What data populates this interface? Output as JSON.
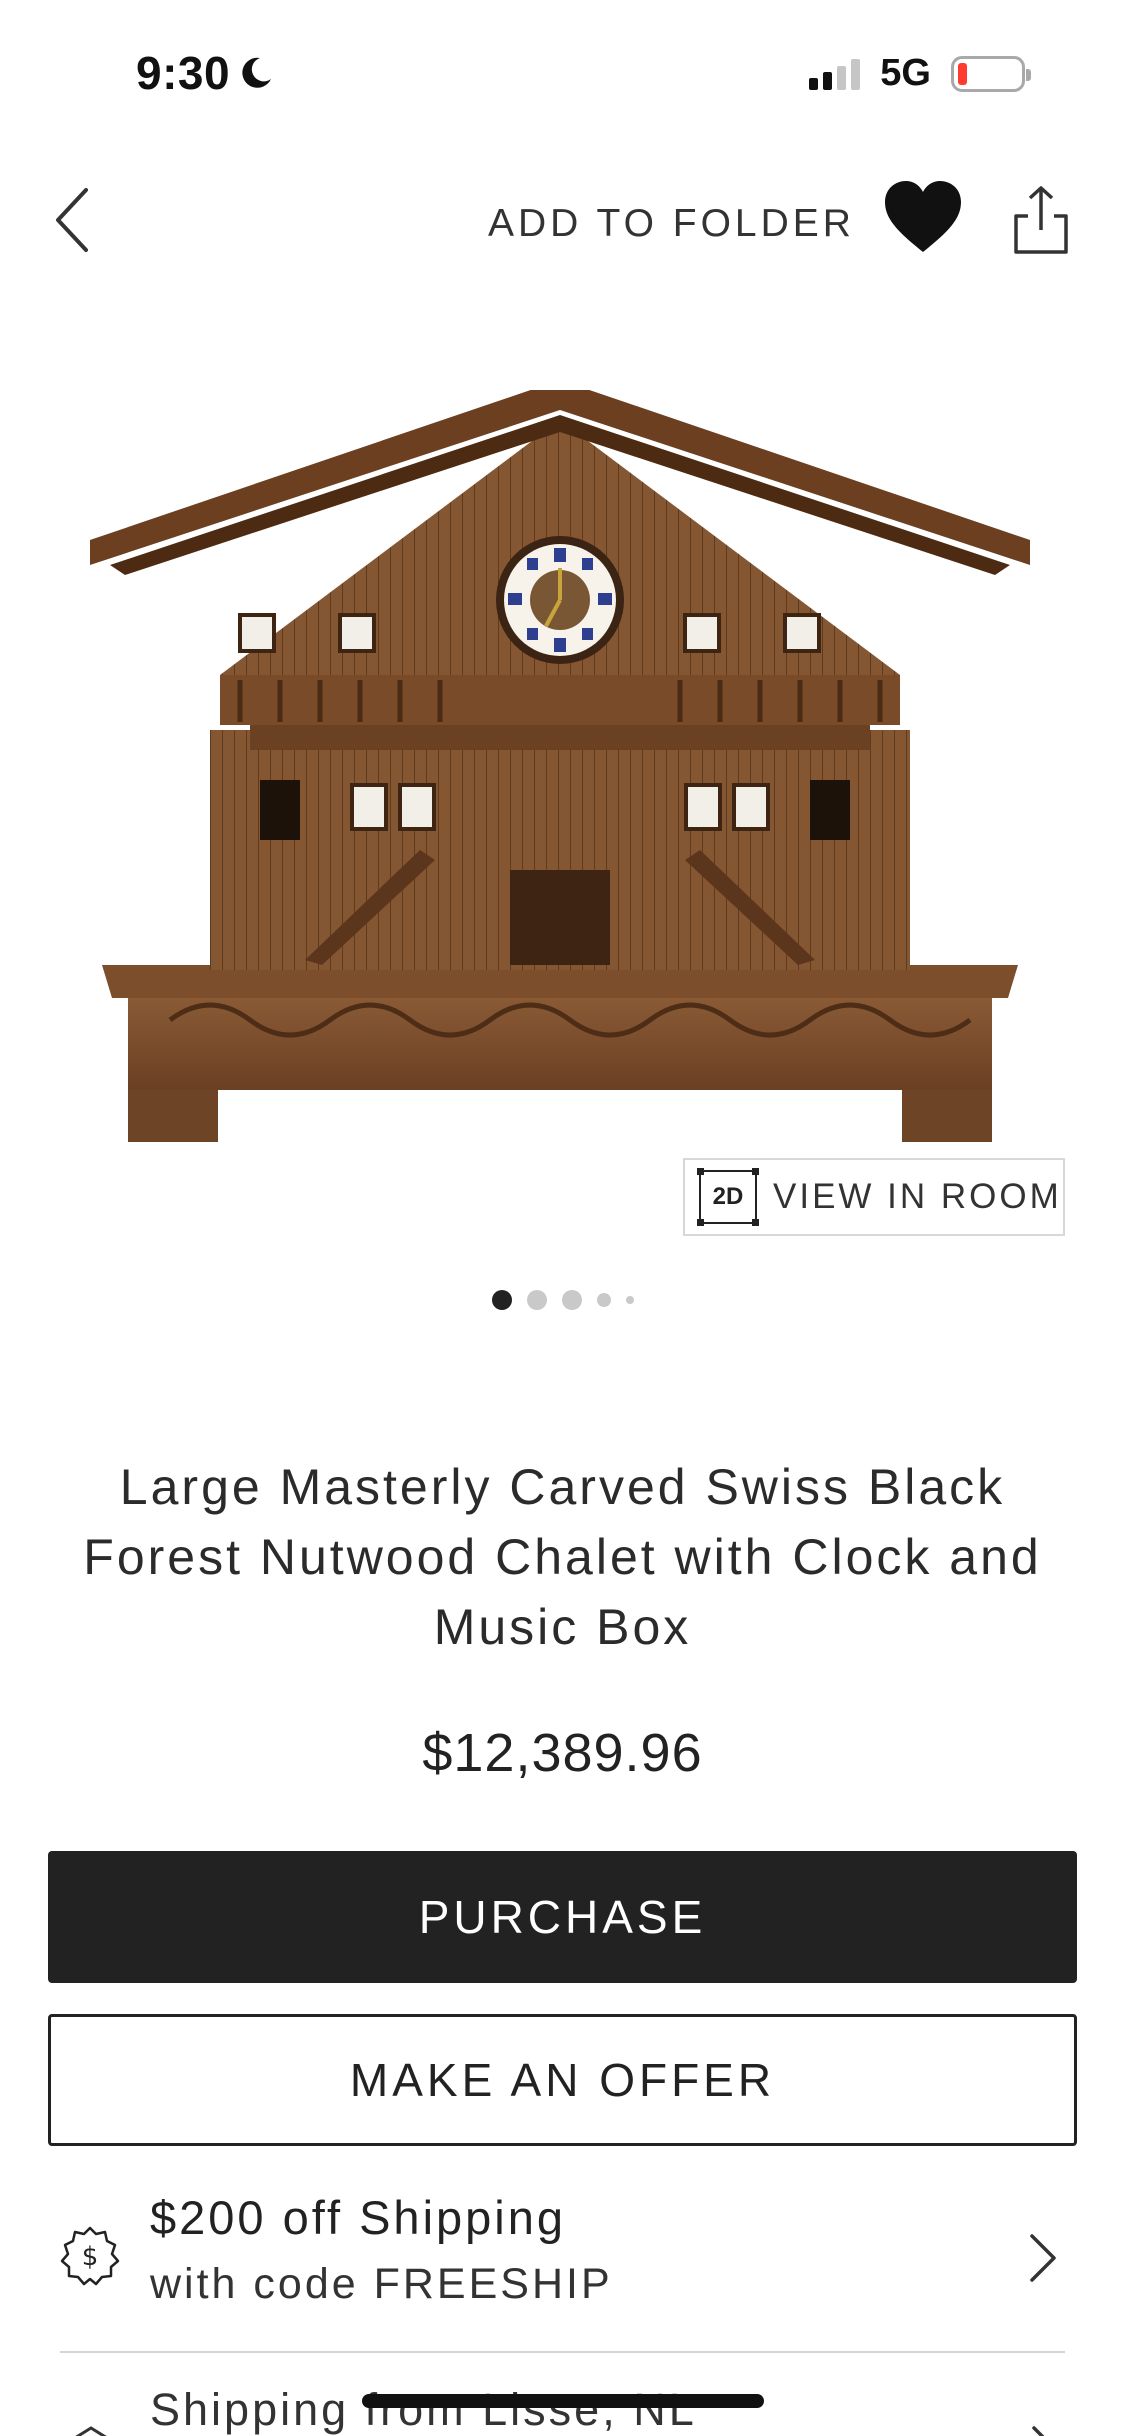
{
  "status_bar": {
    "time": "9:30",
    "network": "5G",
    "signal_bars_active": 2,
    "signal_bars_total": 4,
    "battery_level": 0.08,
    "battery_color": "#ff3b30"
  },
  "nav": {
    "back_icon": "chevron-left-icon",
    "add_to_folder_label": "ADD TO FOLDER",
    "heart_icon": "heart-icon",
    "share_icon": "share-icon"
  },
  "gallery": {
    "image_alt": "carved wooden chalet with clock",
    "view_in_room_badge": "2D",
    "view_in_room_label": "VIEW IN ROOM",
    "page_count": 5,
    "active_index": 0
  },
  "product": {
    "title": "Large Masterly Carved Swiss Black Forest Nutwood Chalet with Clock and Music Box",
    "price": "$12,389.96"
  },
  "actions": {
    "purchase_label": "PURCHASE",
    "offer_label": "MAKE AN OFFER"
  },
  "promo": {
    "icon": "dollar-badge-icon",
    "line1": "$200 off Shipping",
    "line2": "with code FREESHIP"
  },
  "shipping": {
    "icon": "shipping-box-icon",
    "label": "Shipping from Lisse, NL"
  },
  "colors": {
    "primary_button": "#222222",
    "text": "#222222",
    "divider": "#d4d4d4"
  }
}
